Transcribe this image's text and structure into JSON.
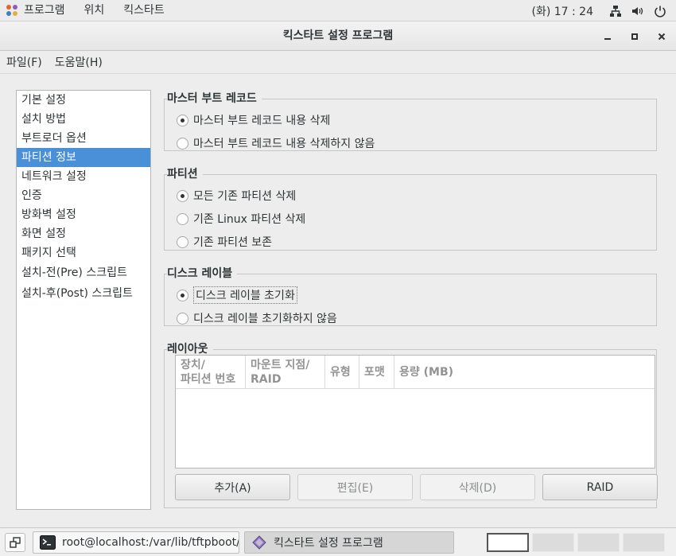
{
  "top_panel": {
    "menus": [
      "프로그램",
      "위치",
      "킥스타트"
    ],
    "clock": "(화) 17 : 24"
  },
  "window": {
    "title": "킥스타트 설정 프로그램"
  },
  "menubar": {
    "file": "파일(F)",
    "help": "도움말(H)"
  },
  "sidebar": {
    "items": [
      {
        "label": "기본 설정"
      },
      {
        "label": "설치 방법"
      },
      {
        "label": "부트로더 옵션"
      },
      {
        "label": "파티션 정보",
        "selected": true
      },
      {
        "label": "네트워크 설정"
      },
      {
        "label": "인증"
      },
      {
        "label": "방화벽 설정"
      },
      {
        "label": "화면 설정"
      },
      {
        "label": "패키지 선택"
      },
      {
        "label": "설치-전(Pre) 스크립트"
      },
      {
        "label": "설치-후(Post) 스크립트"
      }
    ]
  },
  "mbr": {
    "title": "마스터 부트 레코드",
    "options": [
      {
        "label": "마스터 부트 레코드 내용 삭제",
        "selected": true
      },
      {
        "label": "마스터 부트 레코드 내용 삭제하지 않음",
        "selected": false
      }
    ]
  },
  "partitions": {
    "title": "파티션",
    "options": [
      {
        "label": "모든 기존 파티션 삭제",
        "selected": true
      },
      {
        "label": "기존 Linux 파티션 삭제",
        "selected": false
      },
      {
        "label": "기존 파티션 보존",
        "selected": false
      }
    ]
  },
  "disklabel": {
    "title": "디스크 레이블",
    "options": [
      {
        "label": "디스크 레이블 초기화",
        "selected": true
      },
      {
        "label": "디스크 레이블 초기화하지 않음",
        "selected": false
      }
    ]
  },
  "layout": {
    "title": "레이아웃",
    "columns": {
      "device": "장치/\n파티션 번호",
      "mount": "마운트 지점/\nRAID",
      "type": "유형",
      "format": "포맷",
      "size": "용량 (MB)"
    },
    "buttons": {
      "add": "추가(A)",
      "edit": "편집(E)",
      "delete": "삭제(D)",
      "raid": "RAID"
    }
  },
  "taskbar": {
    "task1": "root@localhost:/var/lib/tftpboot/px…",
    "task2": "킥스타트 설정 프로그램"
  }
}
